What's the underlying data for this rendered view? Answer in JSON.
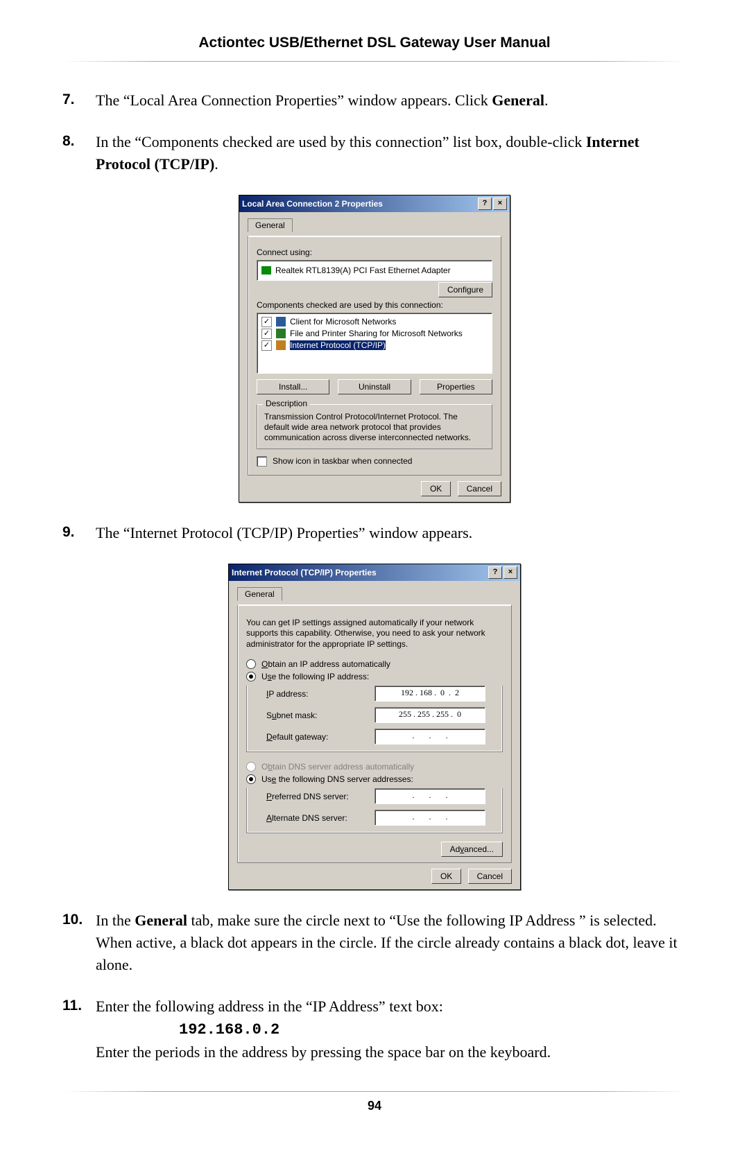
{
  "header": {
    "title": "Actiontec USB/Ethernet DSL Gateway User Manual"
  },
  "page_number": "94",
  "steps": {
    "s7": {
      "num": "7.",
      "text_a": "The “Local Area Connection Properties” window appears. Click ",
      "bold_a": "General",
      "text_b": "."
    },
    "s8": {
      "num": "8.",
      "text_a": "In the “Components checked are used by this connection” list box, double-click ",
      "bold_a": "Internet Protocol (TCP/IP)",
      "text_b": "."
    },
    "s9": {
      "num": "9.",
      "text_a": "The “Internet Protocol (TCP/IP) Properties” window appears."
    },
    "s10": {
      "num": "10.",
      "text_a": "In the ",
      "bold_a": "General",
      "text_b": " tab, make sure the circle next to “Use the following IP Address ” is selected. When active, a black dot appears in the circle. If the circle already contains a black dot, leave it alone."
    },
    "s11": {
      "num": "11.",
      "text_a": "Enter the following address in the “IP Address” text box:",
      "code": "192.168.0.2",
      "text_b": "Enter the periods in the address by pressing the space bar on the keyboard."
    }
  },
  "dlg1": {
    "title": "Local Area Connection 2 Properties",
    "help_btn": "?",
    "close_btn": "×",
    "tab": "General",
    "connect_using_label": "Connect using:",
    "adapter": "Realtek RTL8139(A) PCI Fast Ethernet Adapter",
    "configure_btn": "Configure",
    "components_label": "Components checked are used by this connection:",
    "items": {
      "client": "Client for Microsoft Networks",
      "share": "File and Printer Sharing for Microsoft Networks",
      "tcpip": "Internet Protocol (TCP/IP)"
    },
    "install_btn": "Install...",
    "uninstall_btn": "Uninstall",
    "properties_btn": "Properties",
    "description_legend": "Description",
    "description_text": "Transmission Control Protocol/Internet Protocol. The default wide area network protocol that provides communication across diverse interconnected networks.",
    "show_icon_label": "Show icon in taskbar when connected",
    "ok_btn": "OK",
    "cancel_btn": "Cancel"
  },
  "dlg2": {
    "title": "Internet Protocol (TCP/IP) Properties",
    "help_btn": "?",
    "close_btn": "×",
    "tab": "General",
    "info": "You can get IP settings assigned automatically if your network supports this capability. Otherwise, you need to ask your network administrator for the appropriate IP settings.",
    "radio_obtain_ip": "Obtain an IP address automatically",
    "radio_use_ip": "Use the following IP address:",
    "ip_label": "IP address:",
    "ip_value": "192 . 168 .  0  .  2",
    "subnet_label": "Subnet mask:",
    "subnet_value": "255 . 255 . 255 .  0",
    "gateway_label": "Default gateway:",
    "gateway_value": " .       .       . ",
    "radio_obtain_dns": "Obtain DNS server address automatically",
    "radio_use_dns": "Use the following DNS server addresses:",
    "pref_dns_label": "Preferred DNS server:",
    "pref_dns_value": " .       .       . ",
    "alt_dns_label": "Alternate DNS server:",
    "alt_dns_value": " .       .       . ",
    "advanced_btn": "Advanced...",
    "ok_btn": "OK",
    "cancel_btn": "Cancel"
  }
}
